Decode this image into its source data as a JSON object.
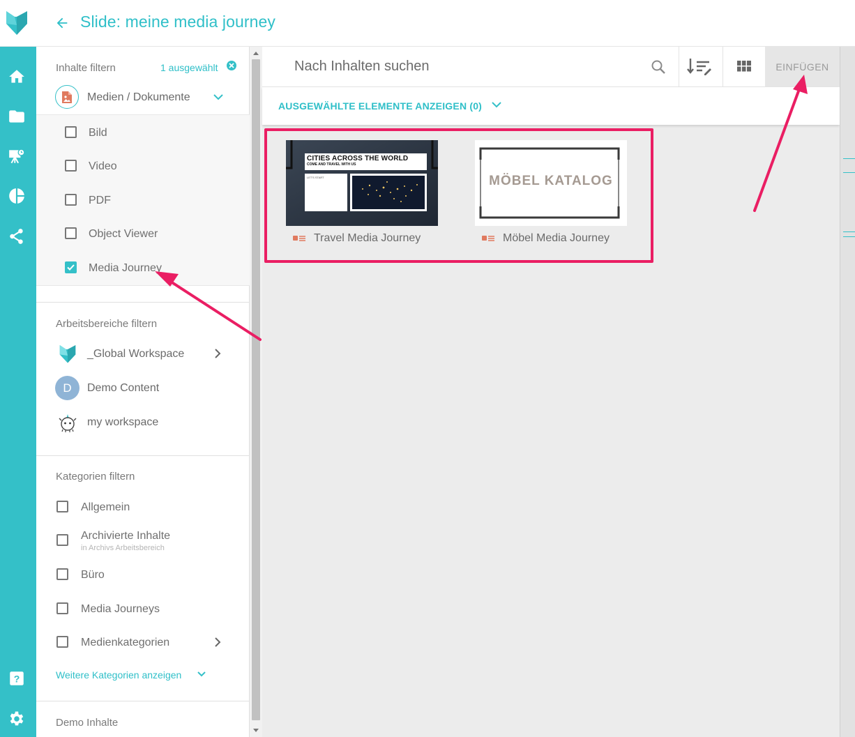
{
  "header": {
    "title": "Slide: meine media journey"
  },
  "filters": {
    "content": {
      "title": "Inhalte filtern",
      "selected_count": "1 ausgewählt",
      "type_dropdown": "Medien / Dokumente",
      "options": [
        {
          "label": "Bild",
          "checked": false
        },
        {
          "label": "Video",
          "checked": false
        },
        {
          "label": "PDF",
          "checked": false
        },
        {
          "label": "Object Viewer",
          "checked": false
        },
        {
          "label": "Media Journey",
          "checked": true
        }
      ]
    },
    "workspaces": {
      "title": "Arbeitsbereiche filtern",
      "items": [
        {
          "label": "_Global Workspace",
          "avatar": "fox-logo-icon"
        },
        {
          "label": "Demo Content",
          "avatar_letter": "D",
          "avatar_color": "#8fb4d6"
        },
        {
          "label": "my workspace",
          "avatar": "unicorn-icon"
        }
      ]
    },
    "categories": {
      "title": "Kategorien filtern",
      "items": [
        {
          "label": "Allgemein"
        },
        {
          "label": "Archivierte Inhalte",
          "sublabel": "in Archivs Arbeitsbereich"
        },
        {
          "label": "Büro"
        },
        {
          "label": "Media Journeys"
        },
        {
          "label": "Medienkategorien"
        }
      ],
      "more_link": "Weitere Kategorien anzeigen"
    },
    "demo": {
      "title": "Demo Inhalte"
    }
  },
  "main": {
    "search_placeholder": "Nach Inhalten suchen",
    "insert_button": "EINFÜGEN",
    "selected_toggle": "AUSGEWÄHLTE ELEMENTE ANZEIGEN (0)",
    "cards": [
      {
        "label": "Travel Media Journey",
        "thumb_heading": "CITIES ACROSS THE WORLD",
        "thumb_subheading": "COME AND TRAVEL WITH US",
        "thumb_small": "LET'S START"
      },
      {
        "label": "Möbel Media Journey",
        "thumb_heading": "MÖBEL KATALOG"
      }
    ]
  },
  "colors": {
    "accent": "#34c0c8",
    "highlight": "#ea1e63",
    "media_icon": "#e07a5f"
  }
}
